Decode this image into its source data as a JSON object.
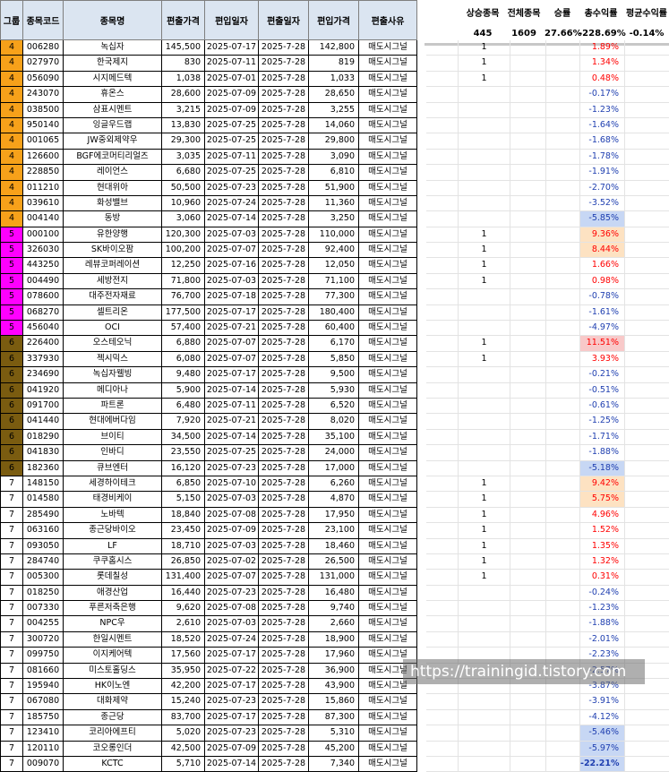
{
  "headers": {
    "group": "그룹",
    "code": "종목코드",
    "name": "종목명",
    "in_price": "편출가격",
    "in_date": "편입일자",
    "out_date": "편출일자",
    "out_price": "편입가격",
    "reason": "편출사유"
  },
  "summary": {
    "rise_label": "상승종목",
    "rise_value": "445",
    "total_label": "전체종목",
    "total_value": "1609",
    "win_label": "승률",
    "win_value": "27.66%",
    "sum_label": "총수익률",
    "sum_value": "-228.69%",
    "avg_label": "평균수익률",
    "avg_value": "-0.14%"
  },
  "colors": {
    "g4": "#f7a11a",
    "g5": "#ff00ff",
    "g6": "#7a5c10",
    "g7": "#ffffff",
    "pos": "#ff0000",
    "neg": "#1f3fb0",
    "hl_orange": "#fde2c2",
    "hl_red": "#f8c9c9",
    "hl_blue": "#c7d7f4"
  },
  "watermark": "https://trainingid.tistory.com",
  "rows": [
    {
      "g": "4",
      "code": "006280",
      "name": "녹십자",
      "p1": "145,500",
      "d1": "2025-07-17",
      "d2": "2025-7-28",
      "p2": "142,800",
      "reason": "매도시그널",
      "up": "1",
      "ret": "1.89%"
    },
    {
      "g": "4",
      "code": "027970",
      "name": "한국제지",
      "p1": "830",
      "d1": "2025-07-11",
      "d2": "2025-7-28",
      "p2": "819",
      "reason": "매도시그널",
      "up": "1",
      "ret": "1.34%"
    },
    {
      "g": "4",
      "code": "056090",
      "name": "시지메드텍",
      "p1": "1,038",
      "d1": "2025-07-01",
      "d2": "2025-7-28",
      "p2": "1,033",
      "reason": "매도시그널",
      "up": "1",
      "ret": "0.48%"
    },
    {
      "g": "4",
      "code": "243070",
      "name": "휴온스",
      "p1": "28,600",
      "d1": "2025-07-09",
      "d2": "2025-7-28",
      "p2": "28,650",
      "reason": "매도시그널",
      "up": "",
      "ret": "-0.17%"
    },
    {
      "g": "4",
      "code": "038500",
      "name": "삼표시멘트",
      "p1": "3,215",
      "d1": "2025-07-09",
      "d2": "2025-7-28",
      "p2": "3,255",
      "reason": "매도시그널",
      "up": "",
      "ret": "-1.23%"
    },
    {
      "g": "4",
      "code": "950140",
      "name": "잉글우드랩",
      "p1": "13,830",
      "d1": "2025-07-25",
      "d2": "2025-7-28",
      "p2": "14,060",
      "reason": "매도시그널",
      "up": "",
      "ret": "-1.64%"
    },
    {
      "g": "4",
      "code": "001065",
      "name": "JW중외제약우",
      "p1": "29,300",
      "d1": "2025-07-25",
      "d2": "2025-7-28",
      "p2": "29,800",
      "reason": "매도시그널",
      "up": "",
      "ret": "-1.68%"
    },
    {
      "g": "4",
      "code": "126600",
      "name": "BGF에코머티리얼즈",
      "p1": "3,035",
      "d1": "2025-07-11",
      "d2": "2025-7-28",
      "p2": "3,090",
      "reason": "매도시그널",
      "up": "",
      "ret": "-1.78%"
    },
    {
      "g": "4",
      "code": "228850",
      "name": "레이언스",
      "p1": "6,680",
      "d1": "2025-07-25",
      "d2": "2025-7-28",
      "p2": "6,810",
      "reason": "매도시그널",
      "up": "",
      "ret": "-1.91%"
    },
    {
      "g": "4",
      "code": "011210",
      "name": "현대위아",
      "p1": "50,500",
      "d1": "2025-07-23",
      "d2": "2025-7-28",
      "p2": "51,900",
      "reason": "매도시그널",
      "up": "",
      "ret": "-2.70%"
    },
    {
      "g": "4",
      "code": "039610",
      "name": "화성밸브",
      "p1": "10,960",
      "d1": "2025-07-24",
      "d2": "2025-7-28",
      "p2": "11,360",
      "reason": "매도시그널",
      "up": "",
      "ret": "-3.52%"
    },
    {
      "g": "4",
      "code": "004140",
      "name": "동방",
      "p1": "3,060",
      "d1": "2025-07-14",
      "d2": "2025-7-28",
      "p2": "3,250",
      "reason": "매도시그널",
      "up": "",
      "ret": "-5.85%",
      "hl": "blue"
    },
    {
      "g": "5",
      "code": "000100",
      "name": "유한양행",
      "p1": "120,300",
      "d1": "2025-07-03",
      "d2": "2025-7-28",
      "p2": "110,000",
      "reason": "매도시그널",
      "up": "1",
      "ret": "9.36%",
      "hl": "orange"
    },
    {
      "g": "5",
      "code": "326030",
      "name": "SK바이오팜",
      "p1": "100,200",
      "d1": "2025-07-07",
      "d2": "2025-7-28",
      "p2": "92,400",
      "reason": "매도시그널",
      "up": "1",
      "ret": "8.44%",
      "hl": "orange"
    },
    {
      "g": "5",
      "code": "443250",
      "name": "레뷰코퍼레이션",
      "p1": "12,250",
      "d1": "2025-07-16",
      "d2": "2025-7-28",
      "p2": "12,050",
      "reason": "매도시그널",
      "up": "1",
      "ret": "1.66%"
    },
    {
      "g": "5",
      "code": "004490",
      "name": "세방전지",
      "p1": "71,800",
      "d1": "2025-07-03",
      "d2": "2025-7-28",
      "p2": "71,100",
      "reason": "매도시그널",
      "up": "1",
      "ret": "0.98%"
    },
    {
      "g": "5",
      "code": "078600",
      "name": "대주전자재료",
      "p1": "76,700",
      "d1": "2025-07-18",
      "d2": "2025-7-28",
      "p2": "77,300",
      "reason": "매도시그널",
      "up": "",
      "ret": "-0.78%"
    },
    {
      "g": "5",
      "code": "068270",
      "name": "셀트리온",
      "p1": "177,500",
      "d1": "2025-07-17",
      "d2": "2025-7-28",
      "p2": "180,400",
      "reason": "매도시그널",
      "up": "",
      "ret": "-1.61%"
    },
    {
      "g": "5",
      "code": "456040",
      "name": "OCI",
      "p1": "57,400",
      "d1": "2025-07-21",
      "d2": "2025-7-28",
      "p2": "60,400",
      "reason": "매도시그널",
      "up": "",
      "ret": "-4.97%"
    },
    {
      "g": "6",
      "code": "226400",
      "name": "오스테오닉",
      "p1": "6,880",
      "d1": "2025-07-07",
      "d2": "2025-7-28",
      "p2": "6,170",
      "reason": "매도시그널",
      "up": "1",
      "ret": "11.51%",
      "hl": "red"
    },
    {
      "g": "6",
      "code": "337930",
      "name": "젝시믹스",
      "p1": "6,080",
      "d1": "2025-07-07",
      "d2": "2025-7-28",
      "p2": "5,850",
      "reason": "매도시그널",
      "up": "1",
      "ret": "3.93%"
    },
    {
      "g": "6",
      "code": "234690",
      "name": "녹십자웰빙",
      "p1": "9,480",
      "d1": "2025-07-17",
      "d2": "2025-7-28",
      "p2": "9,500",
      "reason": "매도시그널",
      "up": "",
      "ret": "-0.21%"
    },
    {
      "g": "6",
      "code": "041920",
      "name": "메디아나",
      "p1": "5,900",
      "d1": "2025-07-14",
      "d2": "2025-7-28",
      "p2": "5,930",
      "reason": "매도시그널",
      "up": "",
      "ret": "-0.51%"
    },
    {
      "g": "6",
      "code": "091700",
      "name": "파트론",
      "p1": "6,480",
      "d1": "2025-07-11",
      "d2": "2025-7-28",
      "p2": "6,520",
      "reason": "매도시그널",
      "up": "",
      "ret": "-0.61%"
    },
    {
      "g": "6",
      "code": "041440",
      "name": "현대에버다임",
      "p1": "7,920",
      "d1": "2025-07-21",
      "d2": "2025-7-28",
      "p2": "8,020",
      "reason": "매도시그널",
      "up": "",
      "ret": "-1.25%"
    },
    {
      "g": "6",
      "code": "018290",
      "name": "브이티",
      "p1": "34,500",
      "d1": "2025-07-14",
      "d2": "2025-7-28",
      "p2": "35,100",
      "reason": "매도시그널",
      "up": "",
      "ret": "-1.71%"
    },
    {
      "g": "6",
      "code": "041830",
      "name": "인바디",
      "p1": "23,550",
      "d1": "2025-07-25",
      "d2": "2025-7-28",
      "p2": "24,000",
      "reason": "매도시그널",
      "up": "",
      "ret": "-1.88%"
    },
    {
      "g": "6",
      "code": "182360",
      "name": "큐브엔터",
      "p1": "16,120",
      "d1": "2025-07-23",
      "d2": "2025-7-28",
      "p2": "17,000",
      "reason": "매도시그널",
      "up": "",
      "ret": "-5.18%",
      "hl": "blue"
    },
    {
      "g": "7",
      "code": "148150",
      "name": "세경하이테크",
      "p1": "6,850",
      "d1": "2025-07-10",
      "d2": "2025-7-28",
      "p2": "6,260",
      "reason": "매도시그널",
      "up": "1",
      "ret": "9.42%",
      "hl": "orange"
    },
    {
      "g": "7",
      "code": "014580",
      "name": "태경비케이",
      "p1": "5,150",
      "d1": "2025-07-03",
      "d2": "2025-7-28",
      "p2": "4,870",
      "reason": "매도시그널",
      "up": "1",
      "ret": "5.75%",
      "hl": "orange"
    },
    {
      "g": "7",
      "code": "285490",
      "name": "노바텍",
      "p1": "18,840",
      "d1": "2025-07-08",
      "d2": "2025-7-28",
      "p2": "17,950",
      "reason": "매도시그널",
      "up": "1",
      "ret": "4.96%"
    },
    {
      "g": "7",
      "code": "063160",
      "name": "종근당바이오",
      "p1": "23,450",
      "d1": "2025-07-09",
      "d2": "2025-7-28",
      "p2": "23,100",
      "reason": "매도시그널",
      "up": "1",
      "ret": "1.52%"
    },
    {
      "g": "7",
      "code": "093050",
      "name": "LF",
      "p1": "18,710",
      "d1": "2025-07-03",
      "d2": "2025-7-28",
      "p2": "18,460",
      "reason": "매도시그널",
      "up": "1",
      "ret": "1.35%"
    },
    {
      "g": "7",
      "code": "284740",
      "name": "쿠쿠홈시스",
      "p1": "26,850",
      "d1": "2025-07-02",
      "d2": "2025-7-28",
      "p2": "26,500",
      "reason": "매도시그널",
      "up": "1",
      "ret": "1.32%"
    },
    {
      "g": "7",
      "code": "005300",
      "name": "롯데칠성",
      "p1": "131,400",
      "d1": "2025-07-07",
      "d2": "2025-7-28",
      "p2": "131,000",
      "reason": "매도시그널",
      "up": "1",
      "ret": "0.31%"
    },
    {
      "g": "7",
      "code": "018250",
      "name": "애경산업",
      "p1": "16,440",
      "d1": "2025-07-23",
      "d2": "2025-7-28",
      "p2": "16,480",
      "reason": "매도시그널",
      "up": "",
      "ret": "-0.24%"
    },
    {
      "g": "7",
      "code": "007330",
      "name": "푸른저축은행",
      "p1": "9,620",
      "d1": "2025-07-08",
      "d2": "2025-7-28",
      "p2": "9,740",
      "reason": "매도시그널",
      "up": "",
      "ret": "-1.23%"
    },
    {
      "g": "7",
      "code": "004255",
      "name": "NPC우",
      "p1": "2,610",
      "d1": "2025-07-03",
      "d2": "2025-7-28",
      "p2": "2,660",
      "reason": "매도시그널",
      "up": "",
      "ret": "-1.88%"
    },
    {
      "g": "7",
      "code": "300720",
      "name": "한일시멘트",
      "p1": "18,520",
      "d1": "2025-07-24",
      "d2": "2025-7-28",
      "p2": "18,900",
      "reason": "매도시그널",
      "up": "",
      "ret": "-2.01%"
    },
    {
      "g": "7",
      "code": "099750",
      "name": "이지케어텍",
      "p1": "17,560",
      "d1": "2025-07-17",
      "d2": "2025-7-28",
      "p2": "17,960",
      "reason": "매도시그널",
      "up": "",
      "ret": "-2.23%"
    },
    {
      "g": "7",
      "code": "081660",
      "name": "미스토홀딩스",
      "p1": "35,950",
      "d1": "2025-07-22",
      "d2": "2025-7-28",
      "p2": "36,900",
      "reason": "매도시그널",
      "up": "",
      "ret": "-2.57%"
    },
    {
      "g": "7",
      "code": "195940",
      "name": "HK이노엔",
      "p1": "42,200",
      "d1": "2025-07-17",
      "d2": "2025-7-28",
      "p2": "43,900",
      "reason": "매도시그널",
      "up": "",
      "ret": "-3.87%"
    },
    {
      "g": "7",
      "code": "067080",
      "name": "대화제약",
      "p1": "15,240",
      "d1": "2025-07-23",
      "d2": "2025-7-28",
      "p2": "15,860",
      "reason": "매도시그널",
      "up": "",
      "ret": "-3.91%"
    },
    {
      "g": "7",
      "code": "185750",
      "name": "종근당",
      "p1": "83,700",
      "d1": "2025-07-17",
      "d2": "2025-7-28",
      "p2": "87,300",
      "reason": "매도시그널",
      "up": "",
      "ret": "-4.12%"
    },
    {
      "g": "7",
      "code": "123410",
      "name": "코리아에프티",
      "p1": "5,020",
      "d1": "2025-07-23",
      "d2": "2025-7-28",
      "p2": "5,310",
      "reason": "매도시그널",
      "up": "",
      "ret": "-5.46%",
      "hl": "blue"
    },
    {
      "g": "7",
      "code": "120110",
      "name": "코오롱인더",
      "p1": "42,500",
      "d1": "2025-07-09",
      "d2": "2025-7-28",
      "p2": "45,200",
      "reason": "매도시그널",
      "up": "",
      "ret": "-5.97%",
      "hl": "blue"
    },
    {
      "g": "7",
      "code": "009070",
      "name": "KCTC",
      "p1": "5,710",
      "d1": "2025-07-14",
      "d2": "2025-7-28",
      "p2": "7,340",
      "reason": "매도시그널",
      "up": "",
      "ret": "-22.21%",
      "hl": "blue"
    }
  ]
}
